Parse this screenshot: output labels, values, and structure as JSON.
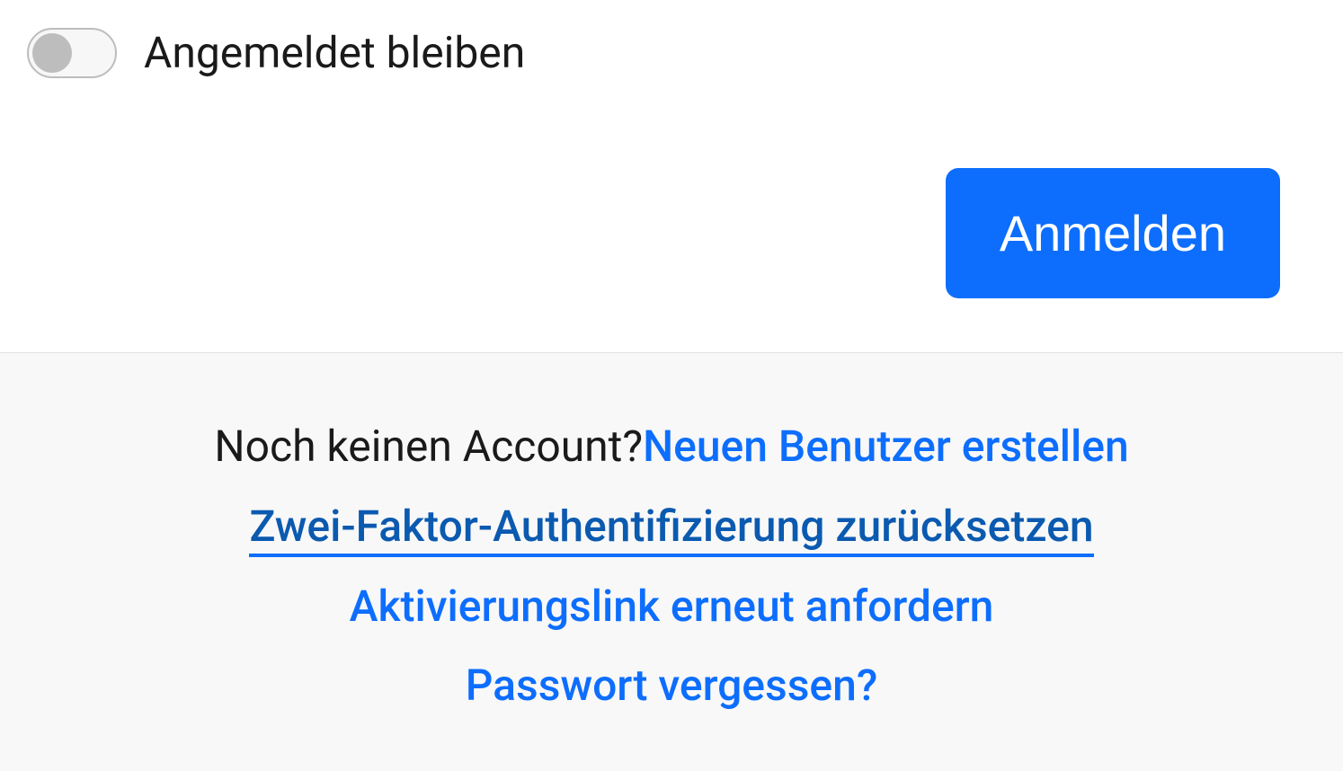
{
  "form": {
    "stay_logged_in_label": "Angemeldet bleiben",
    "submit_label": "Anmelden"
  },
  "footer": {
    "no_account_text": "Noch keinen Account?",
    "create_user_link": "Neuen Benutzer erstellen",
    "reset_2fa_link": "Zwei-Faktor-Authentifizierung zurücksetzen",
    "resend_activation_link": "Aktivierungslink erneut anfordern",
    "forgot_password_link": "Passwort vergessen?"
  },
  "colors": {
    "primary": "#0d6efd",
    "link_dark": "#0b5ab0",
    "footer_bg": "#f8f8f8",
    "toggle_inactive": "#bdbdbd"
  }
}
